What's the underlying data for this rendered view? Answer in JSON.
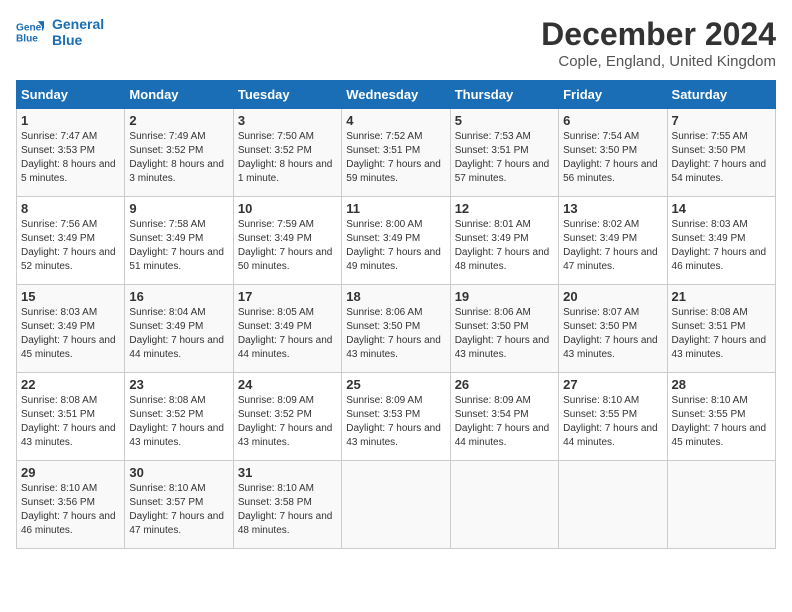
{
  "logo": {
    "line1": "General",
    "line2": "Blue"
  },
  "title": "December 2024",
  "subtitle": "Cople, England, United Kingdom",
  "header_days": [
    "Sunday",
    "Monday",
    "Tuesday",
    "Wednesday",
    "Thursday",
    "Friday",
    "Saturday"
  ],
  "weeks": [
    [
      {
        "day": "1",
        "sunrise": "Sunrise: 7:47 AM",
        "sunset": "Sunset: 3:53 PM",
        "daylight": "Daylight: 8 hours and 5 minutes."
      },
      {
        "day": "2",
        "sunrise": "Sunrise: 7:49 AM",
        "sunset": "Sunset: 3:52 PM",
        "daylight": "Daylight: 8 hours and 3 minutes."
      },
      {
        "day": "3",
        "sunrise": "Sunrise: 7:50 AM",
        "sunset": "Sunset: 3:52 PM",
        "daylight": "Daylight: 8 hours and 1 minute."
      },
      {
        "day": "4",
        "sunrise": "Sunrise: 7:52 AM",
        "sunset": "Sunset: 3:51 PM",
        "daylight": "Daylight: 7 hours and 59 minutes."
      },
      {
        "day": "5",
        "sunrise": "Sunrise: 7:53 AM",
        "sunset": "Sunset: 3:51 PM",
        "daylight": "Daylight: 7 hours and 57 minutes."
      },
      {
        "day": "6",
        "sunrise": "Sunrise: 7:54 AM",
        "sunset": "Sunset: 3:50 PM",
        "daylight": "Daylight: 7 hours and 56 minutes."
      },
      {
        "day": "7",
        "sunrise": "Sunrise: 7:55 AM",
        "sunset": "Sunset: 3:50 PM",
        "daylight": "Daylight: 7 hours and 54 minutes."
      }
    ],
    [
      {
        "day": "8",
        "sunrise": "Sunrise: 7:56 AM",
        "sunset": "Sunset: 3:49 PM",
        "daylight": "Daylight: 7 hours and 52 minutes."
      },
      {
        "day": "9",
        "sunrise": "Sunrise: 7:58 AM",
        "sunset": "Sunset: 3:49 PM",
        "daylight": "Daylight: 7 hours and 51 minutes."
      },
      {
        "day": "10",
        "sunrise": "Sunrise: 7:59 AM",
        "sunset": "Sunset: 3:49 PM",
        "daylight": "Daylight: 7 hours and 50 minutes."
      },
      {
        "day": "11",
        "sunrise": "Sunrise: 8:00 AM",
        "sunset": "Sunset: 3:49 PM",
        "daylight": "Daylight: 7 hours and 49 minutes."
      },
      {
        "day": "12",
        "sunrise": "Sunrise: 8:01 AM",
        "sunset": "Sunset: 3:49 PM",
        "daylight": "Daylight: 7 hours and 48 minutes."
      },
      {
        "day": "13",
        "sunrise": "Sunrise: 8:02 AM",
        "sunset": "Sunset: 3:49 PM",
        "daylight": "Daylight: 7 hours and 47 minutes."
      },
      {
        "day": "14",
        "sunrise": "Sunrise: 8:03 AM",
        "sunset": "Sunset: 3:49 PM",
        "daylight": "Daylight: 7 hours and 46 minutes."
      }
    ],
    [
      {
        "day": "15",
        "sunrise": "Sunrise: 8:03 AM",
        "sunset": "Sunset: 3:49 PM",
        "daylight": "Daylight: 7 hours and 45 minutes."
      },
      {
        "day": "16",
        "sunrise": "Sunrise: 8:04 AM",
        "sunset": "Sunset: 3:49 PM",
        "daylight": "Daylight: 7 hours and 44 minutes."
      },
      {
        "day": "17",
        "sunrise": "Sunrise: 8:05 AM",
        "sunset": "Sunset: 3:49 PM",
        "daylight": "Daylight: 7 hours and 44 minutes."
      },
      {
        "day": "18",
        "sunrise": "Sunrise: 8:06 AM",
        "sunset": "Sunset: 3:50 PM",
        "daylight": "Daylight: 7 hours and 43 minutes."
      },
      {
        "day": "19",
        "sunrise": "Sunrise: 8:06 AM",
        "sunset": "Sunset: 3:50 PM",
        "daylight": "Daylight: 7 hours and 43 minutes."
      },
      {
        "day": "20",
        "sunrise": "Sunrise: 8:07 AM",
        "sunset": "Sunset: 3:50 PM",
        "daylight": "Daylight: 7 hours and 43 minutes."
      },
      {
        "day": "21",
        "sunrise": "Sunrise: 8:08 AM",
        "sunset": "Sunset: 3:51 PM",
        "daylight": "Daylight: 7 hours and 43 minutes."
      }
    ],
    [
      {
        "day": "22",
        "sunrise": "Sunrise: 8:08 AM",
        "sunset": "Sunset: 3:51 PM",
        "daylight": "Daylight: 7 hours and 43 minutes."
      },
      {
        "day": "23",
        "sunrise": "Sunrise: 8:08 AM",
        "sunset": "Sunset: 3:52 PM",
        "daylight": "Daylight: 7 hours and 43 minutes."
      },
      {
        "day": "24",
        "sunrise": "Sunrise: 8:09 AM",
        "sunset": "Sunset: 3:52 PM",
        "daylight": "Daylight: 7 hours and 43 minutes."
      },
      {
        "day": "25",
        "sunrise": "Sunrise: 8:09 AM",
        "sunset": "Sunset: 3:53 PM",
        "daylight": "Daylight: 7 hours and 43 minutes."
      },
      {
        "day": "26",
        "sunrise": "Sunrise: 8:09 AM",
        "sunset": "Sunset: 3:54 PM",
        "daylight": "Daylight: 7 hours and 44 minutes."
      },
      {
        "day": "27",
        "sunrise": "Sunrise: 8:10 AM",
        "sunset": "Sunset: 3:55 PM",
        "daylight": "Daylight: 7 hours and 44 minutes."
      },
      {
        "day": "28",
        "sunrise": "Sunrise: 8:10 AM",
        "sunset": "Sunset: 3:55 PM",
        "daylight": "Daylight: 7 hours and 45 minutes."
      }
    ],
    [
      {
        "day": "29",
        "sunrise": "Sunrise: 8:10 AM",
        "sunset": "Sunset: 3:56 PM",
        "daylight": "Daylight: 7 hours and 46 minutes."
      },
      {
        "day": "30",
        "sunrise": "Sunrise: 8:10 AM",
        "sunset": "Sunset: 3:57 PM",
        "daylight": "Daylight: 7 hours and 47 minutes."
      },
      {
        "day": "31",
        "sunrise": "Sunrise: 8:10 AM",
        "sunset": "Sunset: 3:58 PM",
        "daylight": "Daylight: 7 hours and 48 minutes."
      },
      {
        "day": "",
        "sunrise": "",
        "sunset": "",
        "daylight": ""
      },
      {
        "day": "",
        "sunrise": "",
        "sunset": "",
        "daylight": ""
      },
      {
        "day": "",
        "sunrise": "",
        "sunset": "",
        "daylight": ""
      },
      {
        "day": "",
        "sunrise": "",
        "sunset": "",
        "daylight": ""
      }
    ]
  ]
}
